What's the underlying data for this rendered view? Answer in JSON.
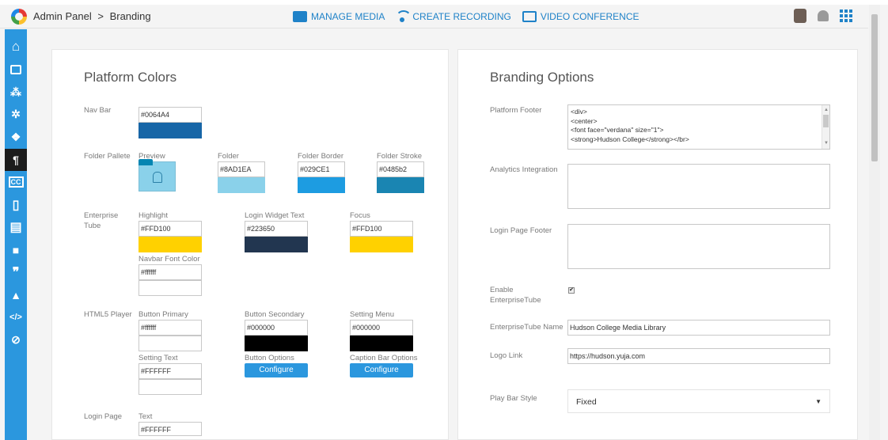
{
  "header": {
    "breadcrumb_root": "Admin Panel",
    "breadcrumb_sep": ">",
    "breadcrumb_current": "Branding",
    "nav": [
      {
        "label": "MANAGE MEDIA",
        "icon": "folder-icon"
      },
      {
        "label": "CREATE RECORDING",
        "icon": "broadcast-icon"
      },
      {
        "label": "VIDEO CONFERENCE",
        "icon": "conference-icon"
      }
    ]
  },
  "sidebar": {
    "items": [
      {
        "name": "home-icon",
        "glyph": "⌂"
      },
      {
        "name": "monitor-icon",
        "glyph": "▭"
      },
      {
        "name": "users-icon",
        "glyph": "⁂"
      },
      {
        "name": "settings-icon",
        "glyph": "✲"
      },
      {
        "name": "integrations-icon",
        "glyph": "❖"
      },
      {
        "name": "branding-icon",
        "glyph": "¶"
      },
      {
        "name": "captions-icon",
        "glyph": "CC"
      },
      {
        "name": "mobile-icon",
        "glyph": "▯"
      },
      {
        "name": "archive-icon",
        "glyph": "▤"
      },
      {
        "name": "video-camera-icon",
        "glyph": "■"
      },
      {
        "name": "quote-icon",
        "glyph": "❞"
      },
      {
        "name": "alert-icon",
        "glyph": "▲"
      },
      {
        "name": "code-icon",
        "glyph": "</>"
      },
      {
        "name": "analytics-search-icon",
        "glyph": "⊘"
      }
    ]
  },
  "platform_colors": {
    "title": "Platform Colors",
    "navbar": {
      "label": "Nav Bar",
      "value": "#0064A4",
      "swatch": "#1766a7"
    },
    "folder": {
      "label": "Folder Pallete",
      "preview_label": "Preview",
      "folder_label": "Folder",
      "folder_value": "#8AD1EA",
      "folder_swatch": "#8ad1ea",
      "border_label": "Folder Border",
      "border_value": "#029CE1",
      "border_swatch": "#1d9ce1",
      "stroke_label": "Folder Stroke",
      "stroke_value": "#0485b2",
      "stroke_swatch": "#1a85b2"
    },
    "enterprise": {
      "label_line1": "Enterprise",
      "label_line2": "Tube",
      "highlight_label": "Highlight",
      "highlight_value": "#FFD100",
      "highlight_swatch": "#ffd100",
      "widget_label": "Login Widget Text",
      "widget_value": "#223650",
      "widget_swatch": "#223650",
      "focus_label": "Focus",
      "focus_value": "#FFD100",
      "focus_swatch": "#ffd100",
      "navfont_label": "Navbar Font Color",
      "navfont_value": "#ffffff",
      "navfont_swatch": "#ffffff"
    },
    "html5": {
      "label": "HTML5 Player",
      "primary_label": "Button Primary",
      "primary_value": "#ffffff",
      "primary_swatch": "#ffffff",
      "secondary_label": "Button Secondary",
      "secondary_value": "#000000",
      "secondary_swatch": "#000000",
      "menu_label": "Setting Menu",
      "menu_value": "#000000",
      "menu_swatch": "#000000",
      "text_label": "Setting Text",
      "text_value": "#FFFFFF",
      "text_swatch": "#ffffff",
      "options_label": "Button Options",
      "options_btn": "Configure",
      "caption_label": "Caption Bar Options",
      "caption_btn": "Configure"
    },
    "login": {
      "label": "Login Page",
      "text_label": "Text",
      "text_value": "#FFFFFF"
    }
  },
  "branding_options": {
    "title": "Branding Options",
    "footer_label": "Platform Footer",
    "footer_lines": [
      "<div>",
      "<center>",
      "<font face=\"verdana\" size=\"1\">",
      "<strong>Hudson College</strong></br>"
    ],
    "analytics_label": "Analytics Integration",
    "analytics_value": "",
    "login_footer_label": "Login Page Footer",
    "login_footer_value": "",
    "enable_label_line1": "Enable",
    "enable_label_line2": "EnterpriseTube",
    "enable_checked": true,
    "tube_name_label": "EnterpriseTube Name",
    "tube_name_value": "Hudson College Media Library",
    "logo_link_label": "Logo Link",
    "logo_link_value": "https://hudson.yuja.com",
    "playbar_label": "Play Bar Style",
    "playbar_value": "Fixed"
  }
}
